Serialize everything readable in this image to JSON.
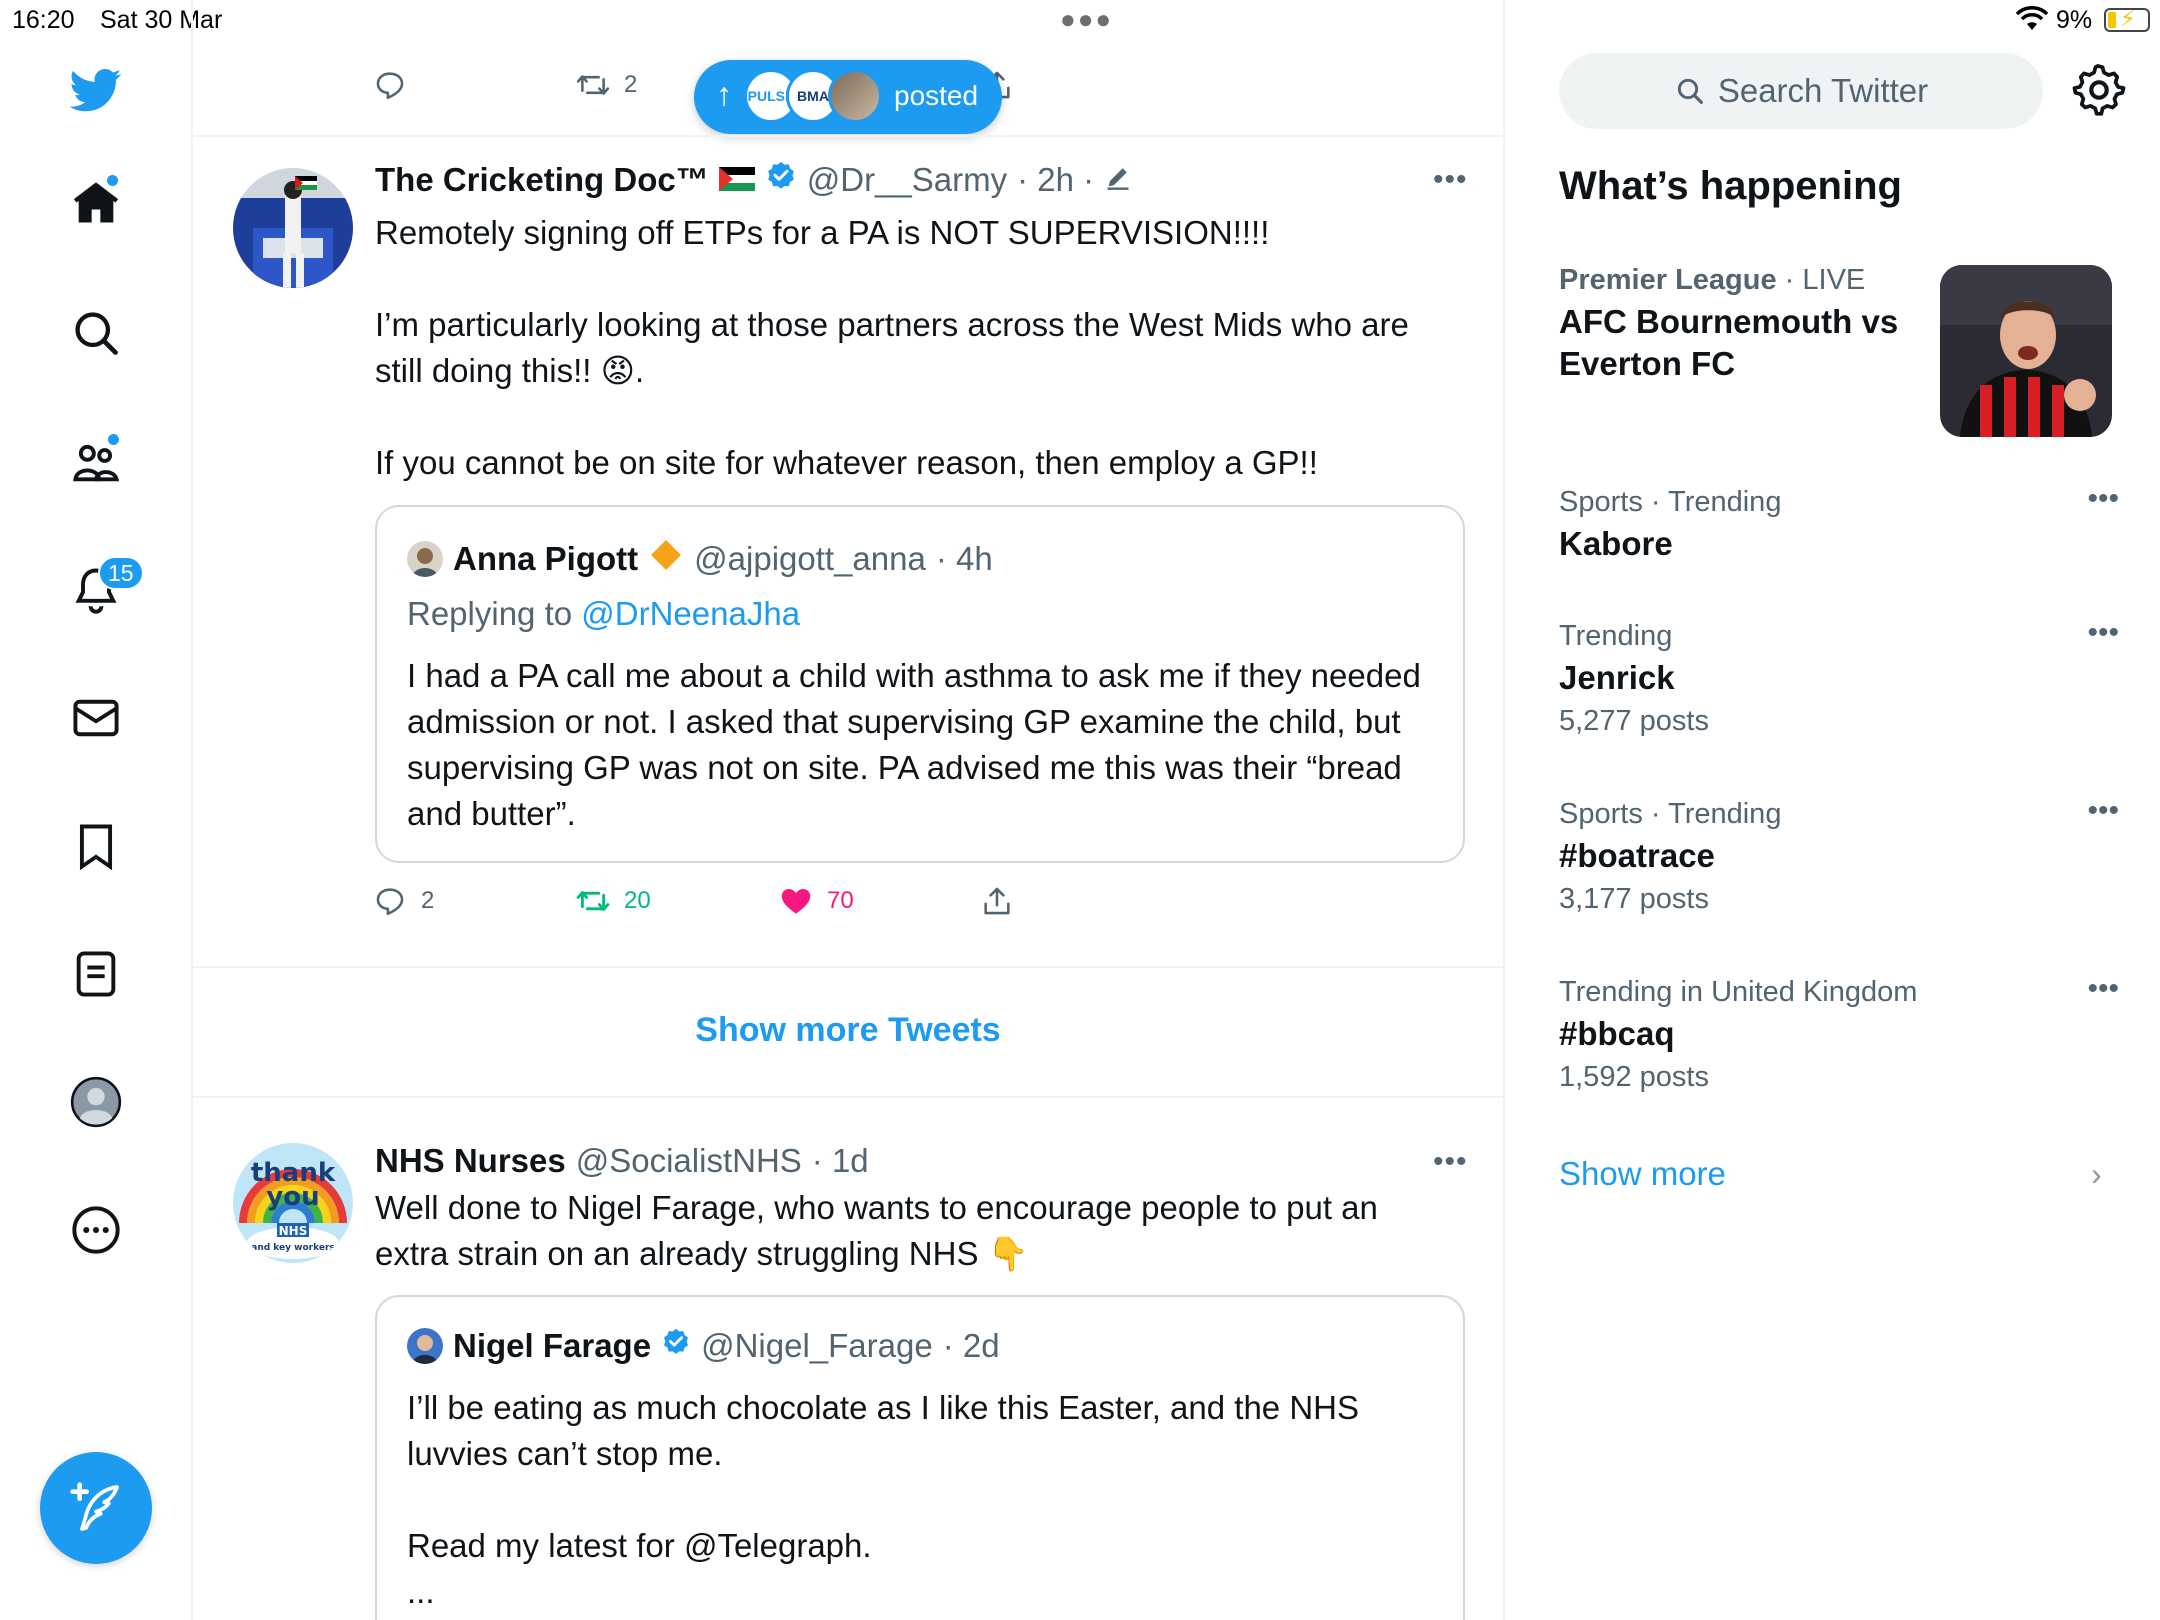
{
  "status_bar": {
    "time": "16:20",
    "date": "Sat 30 Mar",
    "battery": "9%"
  },
  "nav": {
    "notifications_count": "15"
  },
  "top_tweet_actions": {
    "retweets": "2"
  },
  "posted_pill": {
    "label": "posted",
    "avatar1": "PULSE",
    "avatar2": "BMA"
  },
  "tweet1": {
    "name": "The Cricketing Doc™",
    "handle": "@Dr__Sarmy",
    "time": "· 2h ·",
    "para1": "Remotely signing off ETPs for a PA is NOT SUPERVISION!!!!",
    "para2": "I’m particularly looking at those partners across the West Mids who are still doing this!! 😡.",
    "para3": "If you cannot be on site for whatever reason, then employ a GP!!",
    "quote": {
      "name": "Anna Pigott",
      "handle": "@ajpigott_anna",
      "time": "· 4h",
      "replying_to": "Replying to",
      "mention": "@DrNeenaJha",
      "text": "I had a PA call me about a child with asthma to ask me if they needed admission or not. I asked that supervising GP examine the child, but supervising GP was not on site. PA advised me this was their “bread and butter”."
    },
    "replies": "2",
    "retweets": "20",
    "likes": "70"
  },
  "show_more_tweets": "Show more Tweets",
  "tweet2": {
    "name": "NHS Nurses",
    "handle": "@SocialistNHS",
    "time": "· 1d",
    "text": "Well done to Nigel Farage, who wants to encourage people to put an extra strain on an already struggling NHS 👇",
    "avatar_text1": "thank",
    "avatar_text2": "you",
    "avatar_text3": "NHS",
    "avatar_text4": "and key workers",
    "quote": {
      "name": "Nigel Farage",
      "handle": "@Nigel_Farage",
      "time": "· 2d",
      "para1": "I’ll be eating as much chocolate as I like this Easter, and the NHS luvvies can’t stop me.",
      "para2": "Read my latest for @Telegraph.",
      "para3": "..."
    }
  },
  "sidebar": {
    "search_placeholder": "Search Twitter",
    "heading": "What’s happening",
    "featured": {
      "context_bold": "Premier League",
      "context_rest": " · LIVE",
      "title": "AFC Bournemouth vs Everton FC"
    },
    "trends": [
      {
        "context": "Sports · Trending",
        "title": "Kabore",
        "count": ""
      },
      {
        "context": "Trending",
        "title": "Jenrick",
        "count": "5,277 posts"
      },
      {
        "context": "Sports · Trending",
        "title": "#boatrace",
        "count": "3,177 posts"
      },
      {
        "context": "Trending in United Kingdom",
        "title": "#bbcaq",
        "count": "1,592 posts"
      }
    ],
    "show_more": "Show more"
  },
  "colors": {
    "accent": "#1d9bf0",
    "retweet_green": "#00ba7c",
    "like_pink": "#f91880",
    "secondary_text": "#536471"
  }
}
